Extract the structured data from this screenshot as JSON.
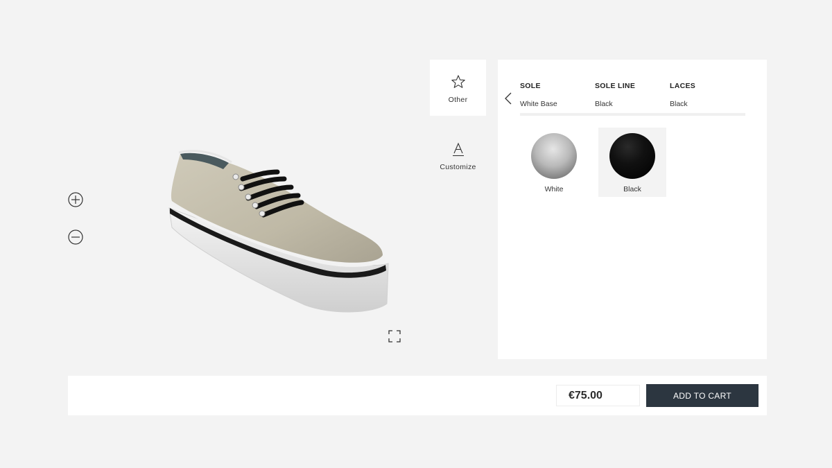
{
  "viewer": {
    "zoom_in_icon": "zoom-in-icon",
    "zoom_out_icon": "zoom-out-icon",
    "fullscreen_icon": "fullscreen-icon"
  },
  "side_tabs": [
    {
      "label": "Other",
      "icon": "star-icon",
      "active": true
    },
    {
      "label": "Customize",
      "icon": "text-a-icon",
      "active": false
    }
  ],
  "options": {
    "parts": [
      {
        "title": "SOLE",
        "value": "White Base"
      },
      {
        "title": "SOLE LINE",
        "value": "Black"
      },
      {
        "title": "LACES",
        "value": "Black"
      }
    ],
    "swatches": [
      {
        "name": "White",
        "color": "#bdbdbd",
        "selected": false
      },
      {
        "name": "Black",
        "color": "#0a0a0a",
        "selected": true
      }
    ]
  },
  "footer": {
    "price": "€75.00",
    "cart_label": "ADD TO CART",
    "cart_color": "#2c3640"
  }
}
